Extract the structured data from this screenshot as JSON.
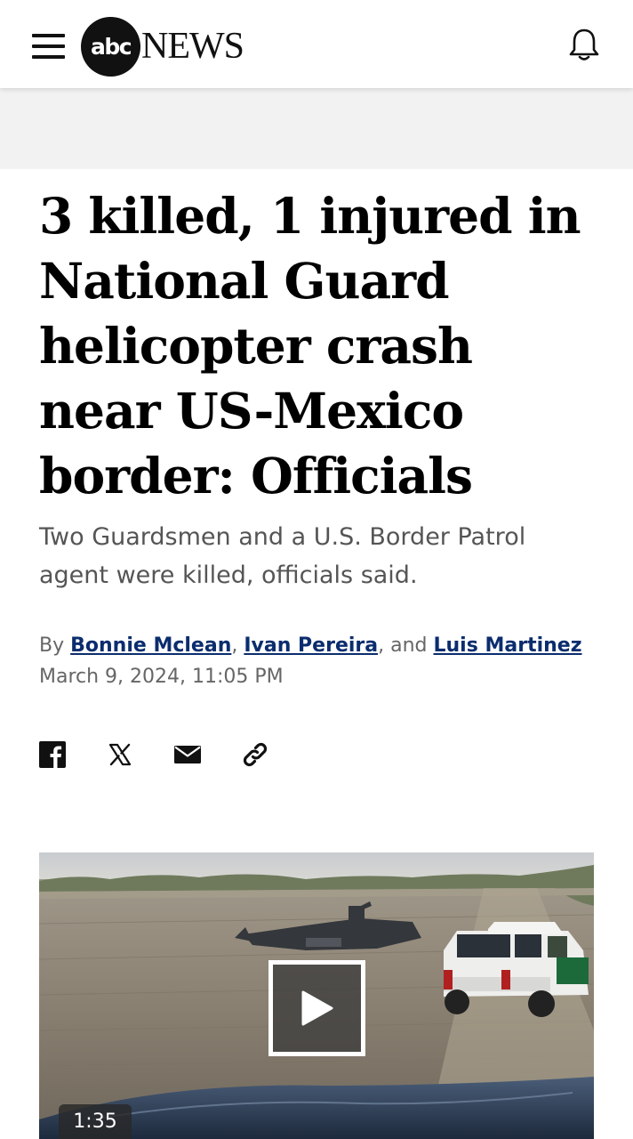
{
  "header": {
    "logo_abc": "abc",
    "logo_news": "NEWS",
    "menu_icon": "hamburger-menu-icon",
    "notification_icon": "bell-icon"
  },
  "article": {
    "headline": "3 killed, 1 injured in National Guard helicopter crash near US-Mexico border: Officials",
    "subheadline": "Two Guardsmen and a U.S. Border Patrol agent were killed, officials said.",
    "byline": {
      "prefix": "By",
      "authors": [
        "Bonnie Mclean",
        "Ivan Pereira",
        "Luis Martinez"
      ],
      "sep1": ",",
      "sep2": ", and"
    },
    "date": "March 9, 2024, 11:05 PM"
  },
  "share": {
    "icons": [
      "facebook-icon",
      "x-icon",
      "email-icon",
      "link-icon"
    ]
  },
  "video": {
    "duration": "1:35",
    "play_icon": "play-icon"
  },
  "colors": {
    "author_link": "#0b2d6e",
    "ad_band": "#f2f2f2"
  }
}
